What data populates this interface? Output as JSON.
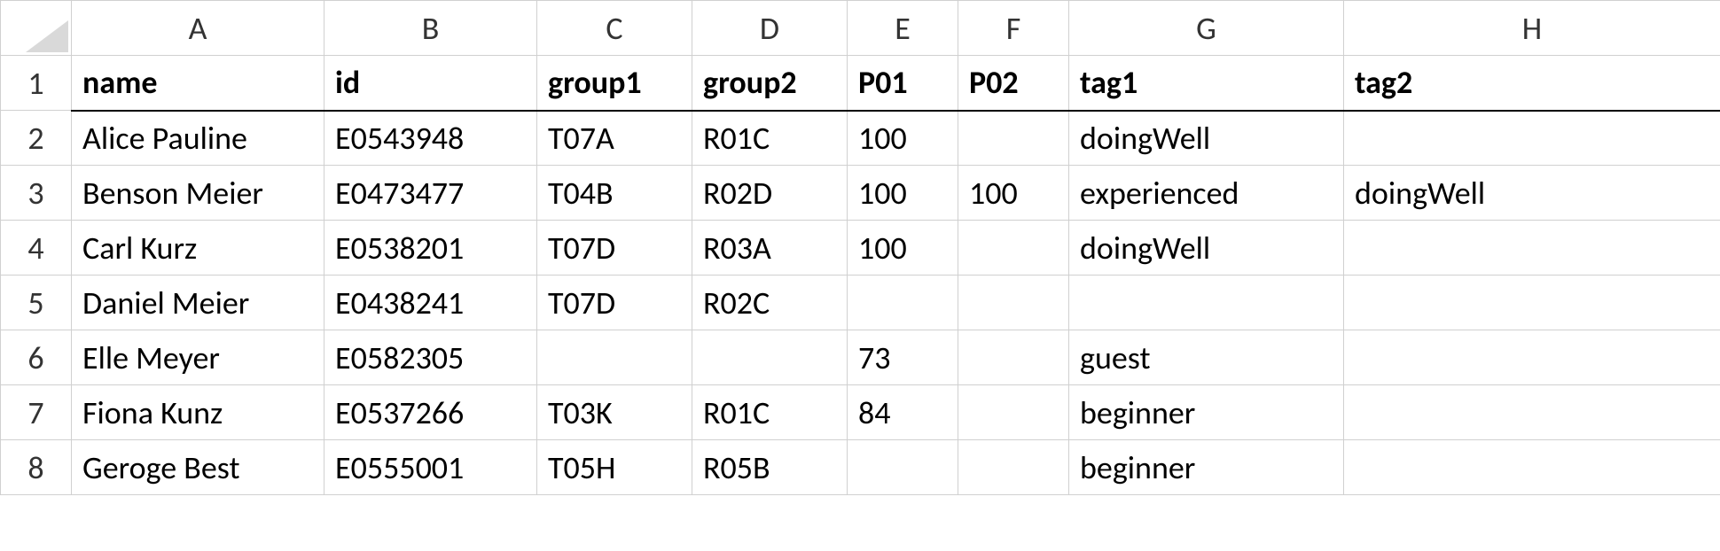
{
  "columns": [
    "A",
    "B",
    "C",
    "D",
    "E",
    "F",
    "G",
    "H"
  ],
  "row_numbers": [
    "1",
    "2",
    "3",
    "4",
    "5",
    "6",
    "7",
    "8"
  ],
  "header": {
    "A": "name",
    "B": "id",
    "C": "group1",
    "D": "group2",
    "E": "P01",
    "F": "P02",
    "G": "tag1",
    "H": "tag2"
  },
  "rows": [
    {
      "A": "Alice Pauline",
      "B": "E0543948",
      "C": "T07A",
      "D": "R01C",
      "E": "100",
      "F": "",
      "G": "doingWell",
      "H": ""
    },
    {
      "A": "Benson Meier",
      "B": "E0473477",
      "C": "T04B",
      "D": "R02D",
      "E": "100",
      "F": "100",
      "G": "experienced",
      "H": "doingWell"
    },
    {
      "A": "Carl Kurz",
      "B": "E0538201",
      "C": "T07D",
      "D": "R03A",
      "E": "100",
      "F": "",
      "G": "doingWell",
      "H": ""
    },
    {
      "A": "Daniel Meier",
      "B": "E0438241",
      "C": "T07D",
      "D": "R02C",
      "E": "",
      "F": "",
      "G": "",
      "H": ""
    },
    {
      "A": "Elle Meyer",
      "B": "E0582305",
      "C": "",
      "D": "",
      "E": "73",
      "F": "",
      "G": "guest",
      "H": ""
    },
    {
      "A": "Fiona Kunz",
      "B": "E0537266",
      "C": "T03K",
      "D": "R01C",
      "E": "84",
      "F": "",
      "G": "beginner",
      "H": ""
    },
    {
      "A": "Geroge Best",
      "B": "E0555001",
      "C": "T05H",
      "D": "R05B",
      "E": "",
      "F": "",
      "G": "beginner",
      "H": ""
    }
  ]
}
